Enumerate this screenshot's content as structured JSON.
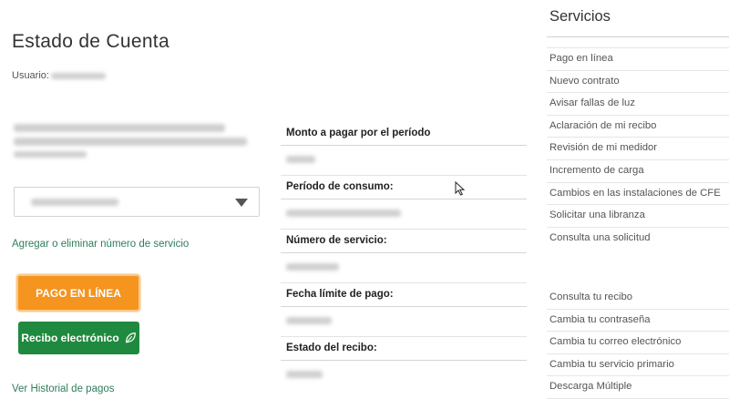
{
  "header": {
    "title": "Estado de Cuenta",
    "user_label": "Usuario:"
  },
  "actions": {
    "manage_link": "Agregar o eliminar número de servicio",
    "pay_button": "PAGO EN LÍNEA",
    "receipt_button": "Recibo electrónico",
    "history_link": "Ver Historial de pagos"
  },
  "details": {
    "amount_label": "Monto a pagar por el período",
    "period_label": "Período de consumo:",
    "service_number_label": "Número de servicio:",
    "due_date_label": "Fecha límite de pago:",
    "status_label": "Estado del recibo:"
  },
  "services": {
    "title": "Servicios",
    "primary": [
      "Pago en línea",
      "Nuevo contrato",
      "Avisar fallas de luz",
      "Aclaración de mi recibo",
      "Revisión de mi medidor",
      "Incremento de carga",
      "Cambios en las instalaciones de CFE",
      "Solicitar una libranza",
      "Consulta una solicitud"
    ],
    "account": [
      "Consulta tu recibo",
      "Cambia tu contraseña",
      "Cambia tu correo electrónico",
      "Cambia tu servicio primario",
      "Descarga Múltiple"
    ]
  },
  "colors": {
    "pay_orange": "#f5941e",
    "receipt_green": "#1f8a3f",
    "link_green": "#2e7d5b"
  },
  "icons": {
    "receipt": "leaf-icon",
    "select": "caret-down-icon",
    "pointer": "mouse-cursor-icon"
  }
}
